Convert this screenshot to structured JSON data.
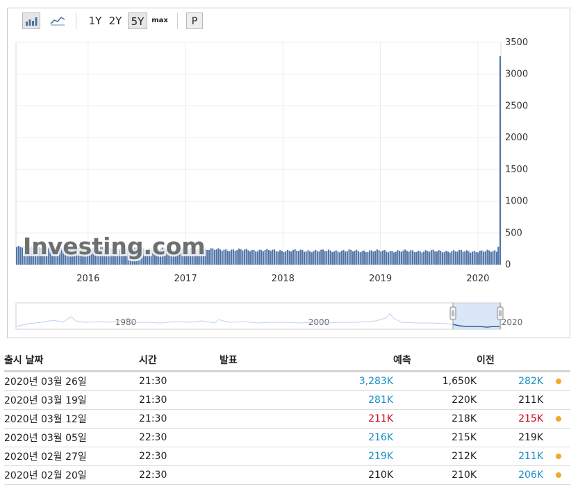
{
  "toolbar": {
    "icons": [
      "bar-chart-icon",
      "line-chart-icon"
    ],
    "ranges": [
      "1Y",
      "2Y",
      "5Y",
      "max"
    ],
    "selected_range": "5Y",
    "p_label": "P"
  },
  "chart_data": {
    "type": "bar",
    "title": "",
    "xlabel": "",
    "ylabel": "",
    "ylim": [
      0,
      3500
    ],
    "y_ticks": [
      "3500",
      "3000",
      "2500",
      "2000",
      "1500",
      "1000",
      "500",
      "0"
    ],
    "x_ticks": [
      "2016",
      "2017",
      "2018",
      "2019",
      "2020"
    ],
    "x_range": [
      "2015-04",
      "2020-03-26"
    ],
    "grid": true,
    "bar_color": "#4f73a6",
    "approx_weekly_values": {
      "2015": 280,
      "2016": 265,
      "2017": 245,
      "2018": 220,
      "2019": 215,
      "2020": 211
    },
    "last_values": [
      {
        "date": "2020-03-19",
        "value": 281
      },
      {
        "date": "2020-03-26",
        "value": 3283
      }
    ],
    "watermark": "Investing.com",
    "navigator": {
      "labels": [
        "1980",
        "2000",
        "2020"
      ]
    }
  },
  "table": {
    "headers": [
      "출시 날짜",
      "시간",
      "발표",
      "예측",
      "이전"
    ],
    "rows": [
      {
        "date": "2020년 03월 26일",
        "time": "21:30",
        "actual": "3,283K",
        "actual_color": "blue",
        "forecast": "1,650K",
        "previous": "282K",
        "previous_color": "blue",
        "dot": true
      },
      {
        "date": "2020년 03월 19일",
        "time": "21:30",
        "actual": "281K",
        "actual_color": "blue",
        "forecast": "220K",
        "previous": "211K",
        "previous_color": "black",
        "dot": false
      },
      {
        "date": "2020년 03월 12일",
        "time": "21:30",
        "actual": "211K",
        "actual_color": "red",
        "forecast": "218K",
        "previous": "215K",
        "previous_color": "red",
        "dot": true
      },
      {
        "date": "2020년 03월 05일",
        "time": "22:30",
        "actual": "216K",
        "actual_color": "blue",
        "forecast": "215K",
        "previous": "219K",
        "previous_color": "black",
        "dot": false
      },
      {
        "date": "2020년 02월 27일",
        "time": "22:30",
        "actual": "219K",
        "actual_color": "blue",
        "forecast": "212K",
        "previous": "211K",
        "previous_color": "blue",
        "dot": true
      },
      {
        "date": "2020년 02월 20일",
        "time": "22:30",
        "actual": "210K",
        "actual_color": "black",
        "forecast": "210K",
        "previous": "206K",
        "previous_color": "blue",
        "dot": true
      }
    ]
  }
}
